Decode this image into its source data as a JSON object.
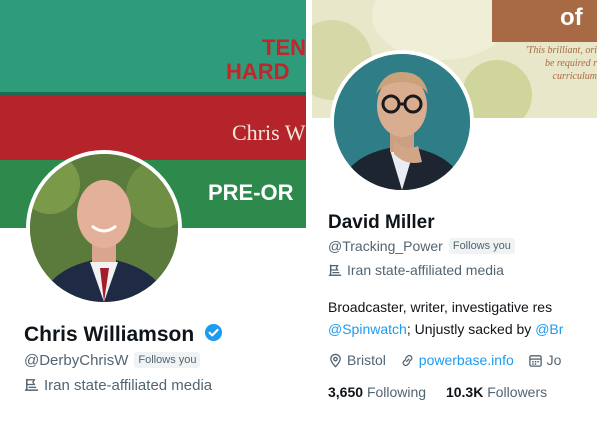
{
  "left_profile": {
    "banner": {
      "line1": "TEN",
      "line2": "HARD",
      "author": "Chris W",
      "cta": "PRE-OR"
    },
    "name": "Chris Williamson",
    "handle": "@DerbyChrisW",
    "follows_badge": "Follows you",
    "label": "Iran state-affiliated media",
    "icons": [
      "verified-badge-icon",
      "state-media-flag-icon"
    ],
    "colors": {
      "verified": "#1d9bf0",
      "banner_green": "#2e9c7a",
      "banner_red": "#b4242a"
    }
  },
  "right_profile": {
    "banner": {
      "heading": "of",
      "quote_line1": "'This brilliant, ori",
      "quote_line2": "be required r",
      "quote_line3": "curriculum"
    },
    "name": "David Miller",
    "handle": "@Tracking_Power",
    "follows_badge": "Follows you",
    "label": "Iran state-affiliated media",
    "bio_line1": "Broadcaster, writer,  investigative res",
    "bio_link1": "@Spinwatch",
    "bio_mid": "; Unjustly sacked by ",
    "bio_link2": "@Br",
    "location": "Bristol",
    "website": "powerbase.info",
    "joined": "Jo",
    "following_count": "3,650",
    "following_label": "Following",
    "followers_count": "10.3K",
    "followers_label": "Followers",
    "icons": [
      "state-media-flag-icon",
      "location-pin-icon",
      "link-icon",
      "calendar-icon"
    ],
    "colors": {
      "link": "#1d9bf0",
      "muted": "#536471"
    }
  }
}
